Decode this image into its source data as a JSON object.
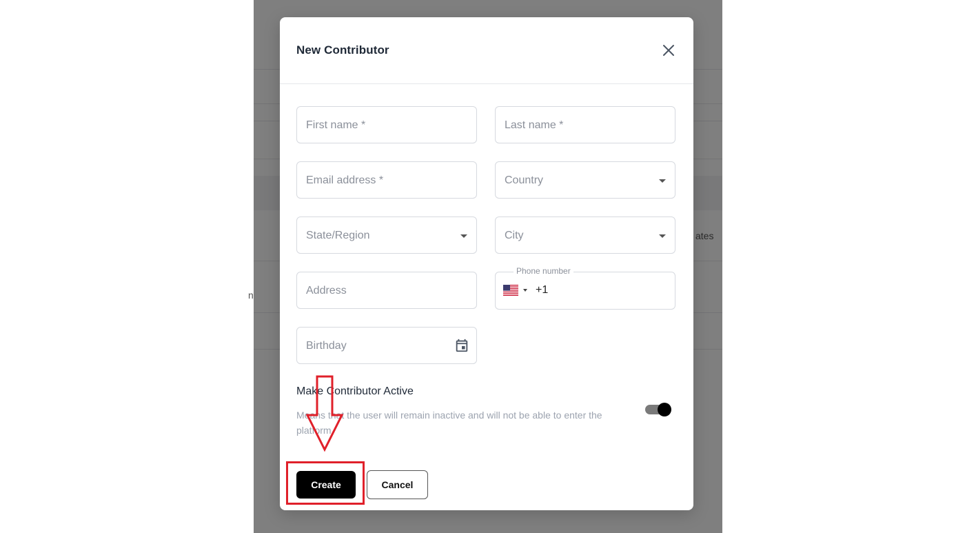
{
  "background": {
    "partial_text_right": "ates",
    "partial_text_left": "n"
  },
  "modal": {
    "title": "New Contributor",
    "close_icon": "close-icon"
  },
  "form": {
    "first_name_placeholder": "First name *",
    "last_name_placeholder": "Last name *",
    "email_placeholder": "Email address *",
    "country_placeholder": "Country",
    "state_placeholder": "State/Region",
    "city_placeholder": "City",
    "address_placeholder": "Address",
    "phone_label": "Phone number",
    "phone_dial_code": "+1",
    "phone_flag": "us-flag-icon",
    "birthday_placeholder": "Birthday",
    "birthday_icon": "calendar-icon"
  },
  "active_toggle": {
    "title": "Make Contributor Active",
    "description": "Means that the user will remain inactive and will not be able to enter the platform",
    "on": true
  },
  "actions": {
    "create_label": "Create",
    "cancel_label": "Cancel"
  },
  "colors": {
    "annotation": "#e0202a",
    "primary_button": "#000000",
    "overlay": "rgba(0,0,0,0.5)"
  }
}
